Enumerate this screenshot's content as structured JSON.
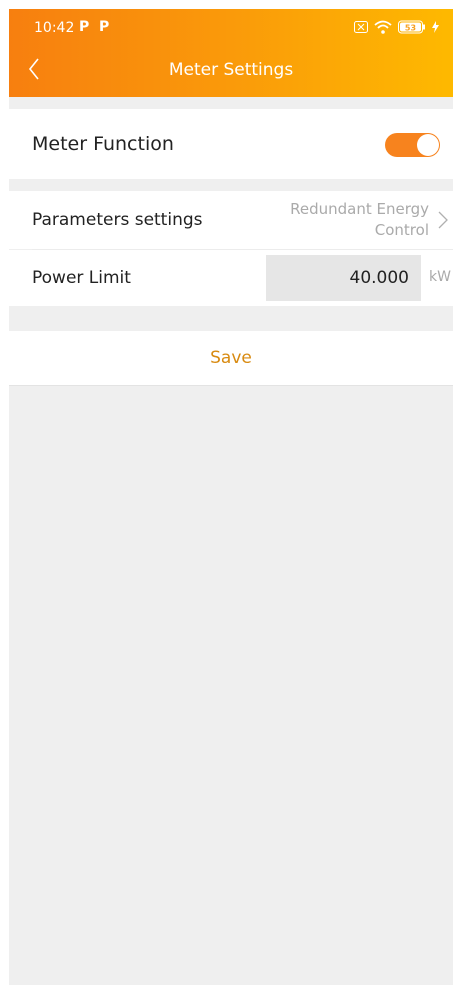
{
  "status_bar": {
    "time": "10:42",
    "notification_icons": [
      "P",
      "P"
    ],
    "battery_level": "53",
    "icons": [
      "sim-icon",
      "wifi-icon",
      "battery-icon",
      "charging-icon"
    ]
  },
  "header": {
    "title": "Meter Settings",
    "back_icon": "chevron-left-icon"
  },
  "meter_function": {
    "label": "Meter Function",
    "enabled": true
  },
  "parameters_settings": {
    "label": "Parameters settings",
    "value_line1": "Redundant Energy",
    "value_line2": "Control"
  },
  "power_limit": {
    "label": "Power Limit",
    "value": "40.000",
    "unit": "kW"
  },
  "save": {
    "label": "Save"
  },
  "colors": {
    "accent": "#f7831e",
    "header_start": "#f77f0f",
    "header_end": "#feb900",
    "save_text": "#d88a10",
    "background": "#efefef"
  }
}
